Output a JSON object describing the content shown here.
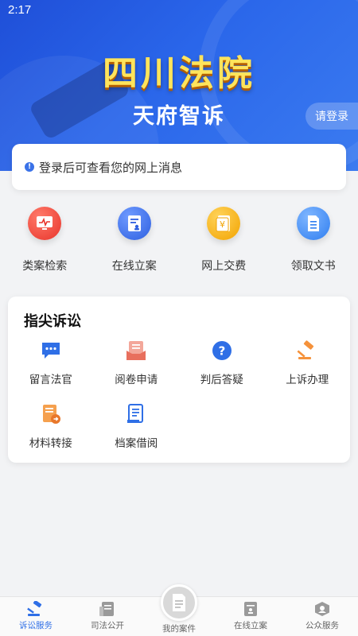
{
  "status_bar": {
    "time": "2:17"
  },
  "banner": {
    "title": "四川法院",
    "subtitle": "天府智诉",
    "login_label": "请登录"
  },
  "notice": {
    "text": "登录后可查看您的网上消息",
    "icon": "info-icon"
  },
  "quick_actions": [
    {
      "label": "类案检索",
      "icon": "case-search-icon",
      "color": "#f0443a"
    },
    {
      "label": "在线立案",
      "icon": "online-filing-icon",
      "color": "#3b6ff0"
    },
    {
      "label": "网上交费",
      "icon": "online-payment-icon",
      "color": "#f7b21d"
    },
    {
      "label": "领取文书",
      "icon": "collect-document-icon",
      "color": "#3b8cf3"
    }
  ],
  "section": {
    "title": "指尖诉讼",
    "items": [
      {
        "label": "留言法官",
        "icon": "message-judge-icon",
        "color": "#2f6fe6"
      },
      {
        "label": "阅卷申请",
        "icon": "file-review-icon",
        "color": "#ef8b7a"
      },
      {
        "label": "判后答疑",
        "icon": "question-icon",
        "color": "#2f6fe6"
      },
      {
        "label": "上诉办理",
        "icon": "gavel-icon",
        "color": "#f5923b"
      },
      {
        "label": "材料转接",
        "icon": "material-transfer-icon",
        "color": "#f5923b"
      },
      {
        "label": "档案借阅",
        "icon": "archive-borrow-icon",
        "color": "#2f6fe6"
      }
    ]
  },
  "bottom_nav": {
    "tabs": [
      {
        "label": "诉讼服务",
        "icon": "litigation-service-icon",
        "active": true
      },
      {
        "label": "司法公开",
        "icon": "judicial-open-icon",
        "active": false
      },
      {
        "label": "我的案件",
        "icon": "my-cases-icon",
        "active": false
      },
      {
        "label": "在线立案",
        "icon": "online-filing-tab-icon",
        "active": false
      },
      {
        "label": "公众服务",
        "icon": "public-service-icon",
        "active": false
      }
    ]
  },
  "colors": {
    "primary": "#2f6fe6",
    "title_yellow": "#ffe45c"
  }
}
